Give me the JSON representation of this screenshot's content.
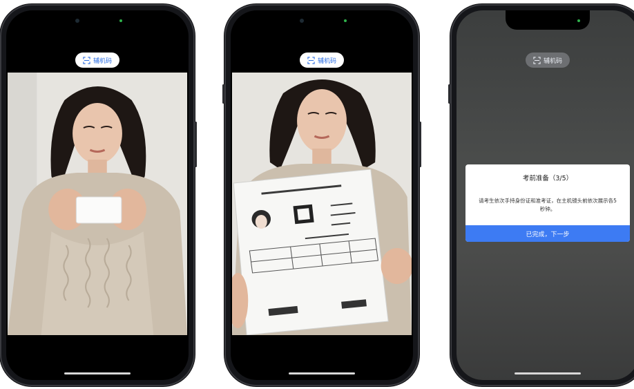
{
  "phones": [
    {
      "badge_label": "辅机码"
    },
    {
      "badge_label": "辅机码"
    },
    {
      "badge_label": "辅机码"
    }
  ],
  "modal": {
    "title": "考前准备（3/5）",
    "body": "请考生依次手持身份证和准考证，在主机镜头前依次展示各5秒钟。",
    "confirm_button": "已完成，下一步"
  },
  "colors": {
    "accent": "#3d7bf3",
    "badge_text": "#2e6fe3",
    "frame": "#15161a"
  },
  "icons": {
    "badge": "scan-frame-icon"
  }
}
